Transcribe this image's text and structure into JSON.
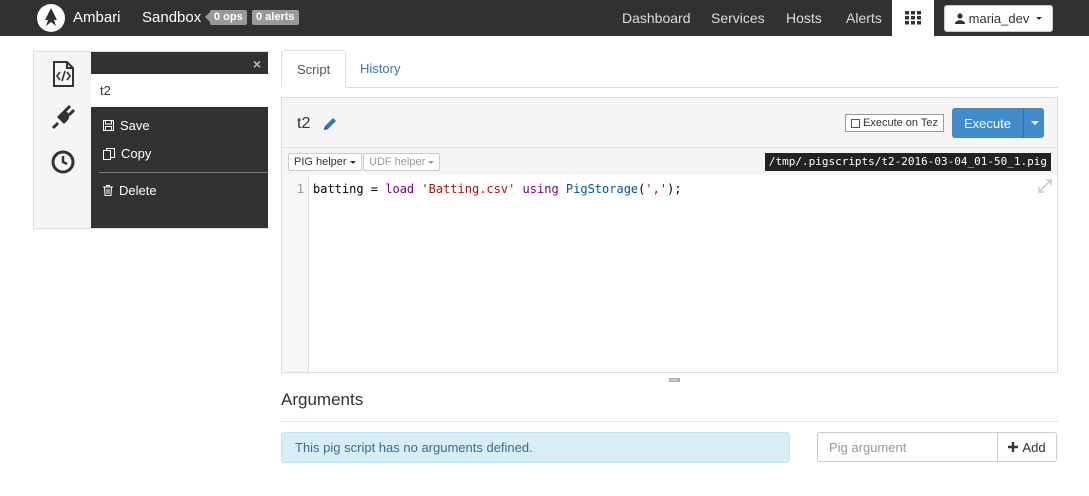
{
  "navbar": {
    "brand": "Ambari",
    "cluster": "Sandbox",
    "ops_badge": "0 ops",
    "alerts_badge": "0 alerts",
    "links": [
      "Dashboard",
      "Services",
      "Hosts",
      "Alerts"
    ],
    "user": "maria_dev"
  },
  "sidebar": {
    "close": "×",
    "title_value": "t2",
    "menu": {
      "save": "Save",
      "copy": "Copy",
      "delete": "Delete"
    }
  },
  "tabs": [
    "Script",
    "History"
  ],
  "editor": {
    "title": "t2",
    "tez_label": "Execute on Tez",
    "tez_checked": false,
    "execute_label": "Execute",
    "pig_helper": "PIG helper",
    "udf_helper": "UDF helper",
    "path": "/tmp/.pigscripts/t2-2016-03-04_01-50_1.pig",
    "line_number": "1",
    "code": {
      "var": "batting = ",
      "load": "load",
      "file": "'Batting.csv'",
      "using": "using",
      "storage": "PigStorage",
      "open": "(",
      "delim": "','",
      "close": ");"
    }
  },
  "arguments": {
    "title": "Arguments",
    "empty_message": "This pig script has no arguments defined.",
    "placeholder": "Pig argument",
    "add_label": "Add"
  },
  "colors": {
    "navbar": "#313131",
    "primary": "#428bca",
    "info_bg": "#d9edf7"
  }
}
